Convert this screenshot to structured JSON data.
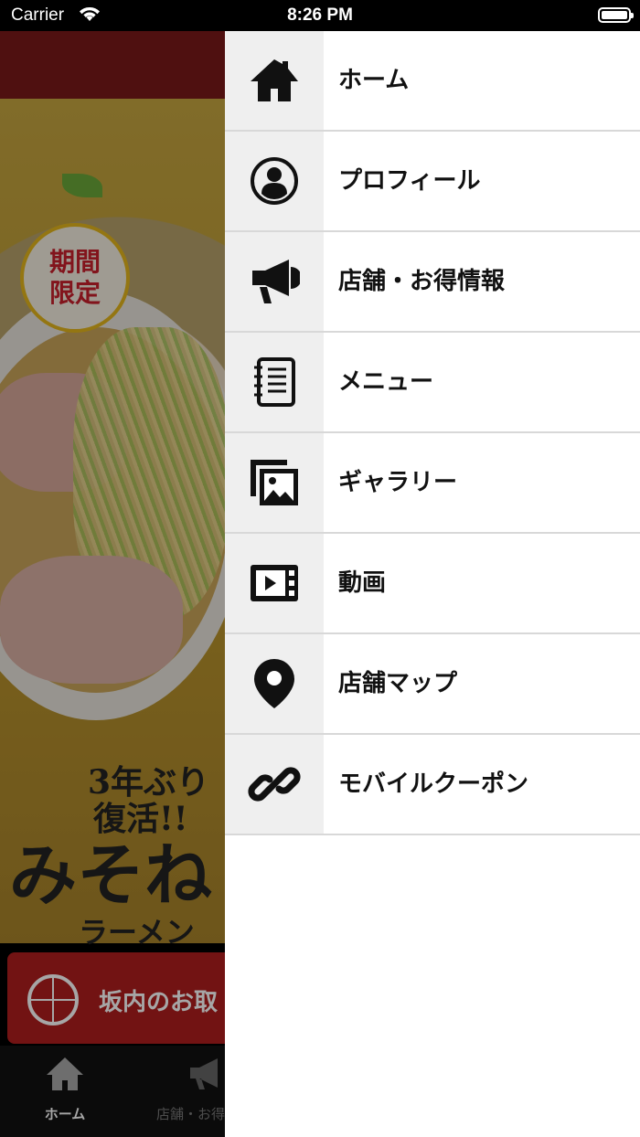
{
  "status_bar": {
    "carrier": "Carrier",
    "time": "8:26 PM"
  },
  "background": {
    "badge_text": "期間\n限定",
    "promo_line1": "3年ぶり",
    "promo_line2": "復活!!",
    "promo_title": "みそね",
    "promo_sub": "ラーメン",
    "translate_label": "坂内のお取",
    "tabs": [
      {
        "label": "ホーム",
        "icon": "home-icon"
      },
      {
        "label": "店舗・お得情",
        "icon": "megaphone-icon"
      }
    ]
  },
  "drawer": {
    "items": [
      {
        "label": "ホーム",
        "icon": "home-icon"
      },
      {
        "label": "プロフィール",
        "icon": "profile-icon"
      },
      {
        "label": "店舗・お得情報",
        "icon": "megaphone-icon"
      },
      {
        "label": "メニュー",
        "icon": "notebook-icon"
      },
      {
        "label": "ギャラリー",
        "icon": "gallery-icon"
      },
      {
        "label": "動画",
        "icon": "video-icon"
      },
      {
        "label": "店舗マップ",
        "icon": "map-pin-icon"
      },
      {
        "label": "モバイルクーポン",
        "icon": "link-icon"
      }
    ]
  }
}
